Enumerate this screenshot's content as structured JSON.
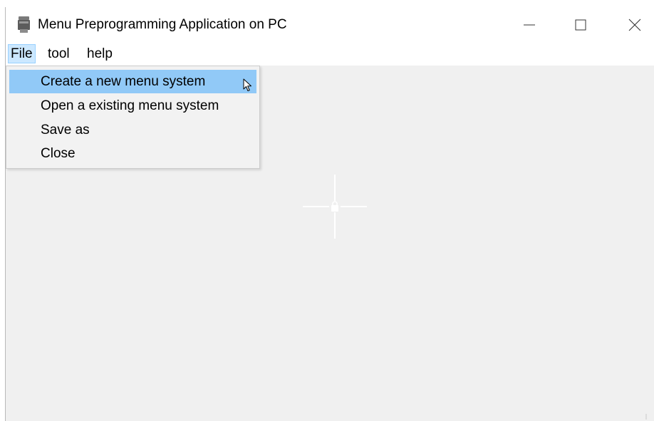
{
  "window": {
    "title": "Menu Preprogramming Application on PC"
  },
  "icons": {
    "app": "printer-app-icon",
    "minimize": "minimize-icon",
    "maximize": "maximize-icon",
    "close": "close-icon",
    "cursor": "mouse-pointer-icon",
    "crosshair": "crosshair-lock-icon"
  },
  "menubar": {
    "items": [
      {
        "label": "File",
        "active": true
      },
      {
        "label": "tool"
      },
      {
        "label": "help"
      }
    ]
  },
  "file_menu": {
    "items": [
      {
        "label": "Create a new menu system",
        "highlighted": true
      },
      {
        "label": "Open a existing menu system"
      },
      {
        "label": "Save as"
      },
      {
        "label": "Close"
      }
    ]
  },
  "colors": {
    "highlight": "#91c9f7",
    "menu_active_bg": "#cce8ff",
    "client_bg": "#f0f0f0"
  }
}
